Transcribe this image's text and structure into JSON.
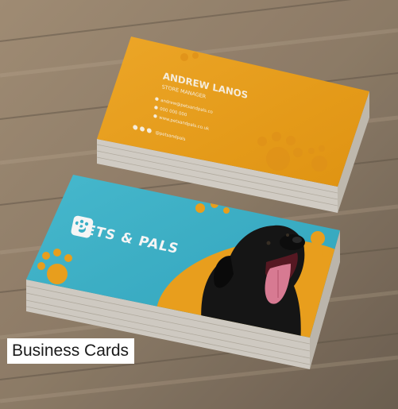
{
  "photo": {
    "back_card": {
      "name": "ANDREW LANOS",
      "role": "STORE MANAGER",
      "contact_lines": [
        "andrew@petsandpals.co",
        "000 000 000",
        "www.petsandpals.co.uk"
      ],
      "social_handle": "@petsandpals"
    },
    "front_card": {
      "brand": "PETS & PALS"
    },
    "colors": {
      "wood": "#9a8670",
      "orange": "#f2a51f",
      "turquoise": "#3cb7cf",
      "dog": "#141414"
    }
  },
  "caption": "Business Cards"
}
